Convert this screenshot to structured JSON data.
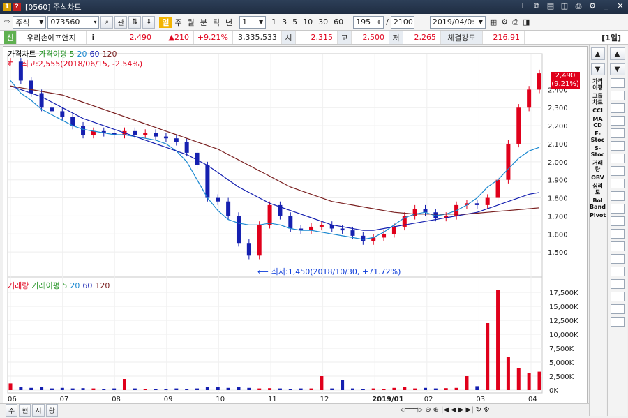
{
  "window": {
    "code": "[0560]",
    "title": "주식차트",
    "badge1": "1",
    "badge2": "?"
  },
  "toolbar": {
    "market": "주식",
    "code": "073560",
    "search_label": "관",
    "periods": [
      "일",
      "주",
      "월",
      "분",
      "틱",
      "년"
    ],
    "interval": "1",
    "presets": [
      "1",
      "3",
      "5",
      "10",
      "30",
      "60"
    ],
    "count": "195",
    "total": "2100",
    "date": "2019/04/0:"
  },
  "info": {
    "name_tag": "신",
    "name": "우리손에프앤지",
    "price": "2,490",
    "change": "▲210",
    "rate": "+9.21%",
    "volume": "3,335,533",
    "open_label": "시",
    "open": "2,315",
    "high_label": "고",
    "high": "2,500",
    "low_label": "저",
    "low": "2,265",
    "strength_label": "체결강도",
    "strength": "216.91",
    "period_label": "[1일]"
  },
  "price_chart": {
    "legend": [
      "가격차트",
      "가격이평 5",
      "20",
      "60",
      "120"
    ],
    "high_note": "최고:2,555(2018/06/15, -2.54%)",
    "low_note": "최저:1,450(2018/10/30, +71.72%)",
    "current_price": "2,490",
    "current_rate": "(9.21%)"
  },
  "volume_chart": {
    "legend": [
      "거래량",
      "거래이평 5",
      "20",
      "60",
      "120"
    ]
  },
  "chart_data": [
    {
      "type": "line",
      "title": "가격차트",
      "ylim": [
        1400,
        2560
      ],
      "y_ticks": [
        "2,400",
        "2,300",
        "2,200",
        "2,100",
        "2,000",
        "1,900",
        "1,800",
        "1,700",
        "1,600",
        "1,500"
      ],
      "x_ticks": [
        "06",
        "07",
        "08",
        "09",
        "10",
        "11",
        "12",
        "2019/01",
        "02",
        "03",
        "04"
      ],
      "series": [
        {
          "name": "가격차트",
          "values": [
            2555,
            2450,
            2380,
            2300,
            2280,
            2250,
            2200,
            2150,
            2170,
            2160,
            2150,
            2170,
            2150,
            2160,
            2140,
            2130,
            2110,
            2050,
            1980,
            1800,
            1780,
            1700,
            1550,
            1480,
            1650,
            1760,
            1700,
            1630,
            1620,
            1640,
            1650,
            1630,
            1620,
            1590,
            1560,
            1580,
            1600,
            1640,
            1700,
            1740,
            1720,
            1690,
            1700,
            1760,
            1770,
            1760,
            1800,
            1900,
            2100,
            2300,
            2400,
            2490
          ]
        },
        {
          "name": "20",
          "values": [
            2450,
            2380,
            2340,
            2290,
            2260,
            2230,
            2200,
            2180,
            2170,
            2160,
            2150,
            2150,
            2140,
            2130,
            2120,
            2100,
            2060,
            2000,
            1900,
            1800,
            1730,
            1680,
            1660,
            1650,
            1650,
            1660,
            1650,
            1630,
            1620,
            1620,
            1610,
            1600,
            1590,
            1580,
            1570,
            1580,
            1610,
            1650,
            1690,
            1710,
            1720,
            1700,
            1710,
            1730,
            1760,
            1800,
            1860,
            1900,
            1960,
            2020,
            2060,
            2080
          ]
        },
        {
          "name": "60",
          "values": [
            2420,
            2400,
            2380,
            2360,
            2330,
            2300,
            2270,
            2240,
            2220,
            2200,
            2180,
            2160,
            2140,
            2120,
            2100,
            2080,
            2060,
            2040,
            2010,
            1980,
            1940,
            1900,
            1860,
            1830,
            1800,
            1770,
            1750,
            1730,
            1710,
            1690,
            1670,
            1650,
            1640,
            1630,
            1620,
            1620,
            1630,
            1640,
            1650,
            1660,
            1670,
            1680,
            1690,
            1700,
            1710,
            1720,
            1740,
            1760,
            1780,
            1800,
            1820,
            1830
          ]
        },
        {
          "name": "120",
          "values": [
            2420,
            2410,
            2400,
            2390,
            2380,
            2370,
            2350,
            2330,
            2310,
            2290,
            2270,
            2250,
            2230,
            2210,
            2190,
            2170,
            2150,
            2130,
            2110,
            2090,
            2070,
            2040,
            2010,
            1980,
            1950,
            1920,
            1890,
            1860,
            1840,
            1820,
            1800,
            1780,
            1770,
            1760,
            1750,
            1740,
            1730,
            1720,
            1715,
            1710,
            1710,
            1710,
            1710,
            1710,
            1710,
            1715,
            1720,
            1725,
            1730,
            1735,
            1740,
            1745
          ]
        }
      ]
    },
    {
      "type": "bar",
      "title": "거래량",
      "ylim": [
        0,
        18500
      ],
      "y_ticks": [
        "17,500K",
        "15,000K",
        "12,500K",
        "10,000K",
        "7,500K",
        "5,000K",
        "2,500K",
        "0K"
      ],
      "values": [
        1200,
        600,
        400,
        500,
        300,
        400,
        300,
        350,
        300,
        250,
        300,
        2000,
        300,
        200,
        250,
        200,
        300,
        250,
        300,
        600,
        500,
        400,
        500,
        400,
        300,
        350,
        300,
        250,
        300,
        300,
        2500,
        300,
        1800,
        300,
        250,
        300,
        250,
        400,
        500,
        300,
        400,
        300,
        350,
        400,
        2500,
        700,
        12000,
        18000,
        6000,
        4000,
        3000,
        3300
      ]
    }
  ]
}
